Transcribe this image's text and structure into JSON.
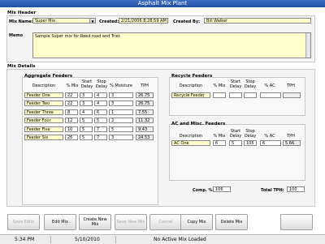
{
  "window": {
    "title": "Asphalt Mix Plant"
  },
  "mix_header": {
    "section_label": "Mix Header",
    "mix_name_label": "Mix Name:",
    "mix_name_value": "Super Mix",
    "created_label": "Created:",
    "created_value": "2/21/2006 8:28:59 AM",
    "created_by_label": "Created By:",
    "created_by_value": "Bill Walker",
    "memo_label": "Memo",
    "memo_value": "Sample Super mix for Reed road and Trier."
  },
  "mix_details": {
    "section_label": "Mix Details"
  },
  "aggregate_feeders": {
    "title": "Aggregate Feeders",
    "columns": {
      "description": "Description",
      "mix": "% Mix",
      "start_delay": "Start Delay",
      "stop_delay": "Stop Delay",
      "moisture": "% Moisture",
      "tph": "TPH"
    },
    "rows": [
      {
        "description": "Feeder One",
        "mix": "22",
        "start": "3",
        "stop": "4",
        "moisture": "3",
        "tph": "26.75"
      },
      {
        "description": "Feeder Two",
        "mix": "22",
        "start": "3",
        "stop": "4",
        "moisture": "3",
        "tph": "26.75"
      },
      {
        "description": "Feeder Three",
        "mix": "8",
        "start": "4",
        "stop": "6",
        "moisture": "1",
        "tph": "7.55"
      },
      {
        "description": "Feeder Four",
        "mix": "12",
        "start": "5",
        "stop": "5",
        "moisture": "2",
        "tph": "11.32"
      },
      {
        "description": "Feeder Five",
        "mix": "10",
        "start": "5",
        "stop": "7",
        "moisture": "5",
        "tph": "9.43"
      },
      {
        "description": "Feeder Six",
        "mix": "26",
        "start": "5",
        "stop": "7",
        "moisture": "3",
        "tph": "24.53"
      }
    ]
  },
  "recycle_feeders": {
    "title": "Recycle Feeders",
    "columns": {
      "description": "Description",
      "mix": "% Mix",
      "start_delay": "Start Delay",
      "stop_delay": "Stop Delay",
      "ac": "% AC",
      "tph": "TPH"
    },
    "rows": [
      {
        "description": "Recycle Feeder",
        "mix": "",
        "start": "",
        "stop": "",
        "ac": "",
        "tph": ""
      }
    ]
  },
  "ac_misc_feeders": {
    "title": "AC and Misc. Feeders",
    "columns": {
      "description": "Description",
      "mix": "% Mix",
      "start_delay": "Start Delay",
      "stop_delay": "Stop Delay",
      "ac": "% AC",
      "tph": "TPH"
    },
    "rows": [
      {
        "description": "AC One",
        "mix": "6",
        "start": "5",
        "stop": "105",
        "ac": "6",
        "tph": "5.66"
      }
    ]
  },
  "totals": {
    "comp_label": "Comp. %",
    "comp_value": "106",
    "total_tph_label": "Total TPH:",
    "total_tph_value": "100"
  },
  "toolbar": {
    "save_edits": "Save Edits",
    "edit_mix": "Edit Mix",
    "create_new_mix": "Create New Mix",
    "save_new_mix": "Save New Mix",
    "cancel": "Cancel",
    "copy_mix": "Copy Mix",
    "delete_mix": "Delete Mix"
  },
  "status_bar": {
    "time": "5:34 PM",
    "date": "5/10/2010",
    "message": "No Active Mix Loaded"
  }
}
